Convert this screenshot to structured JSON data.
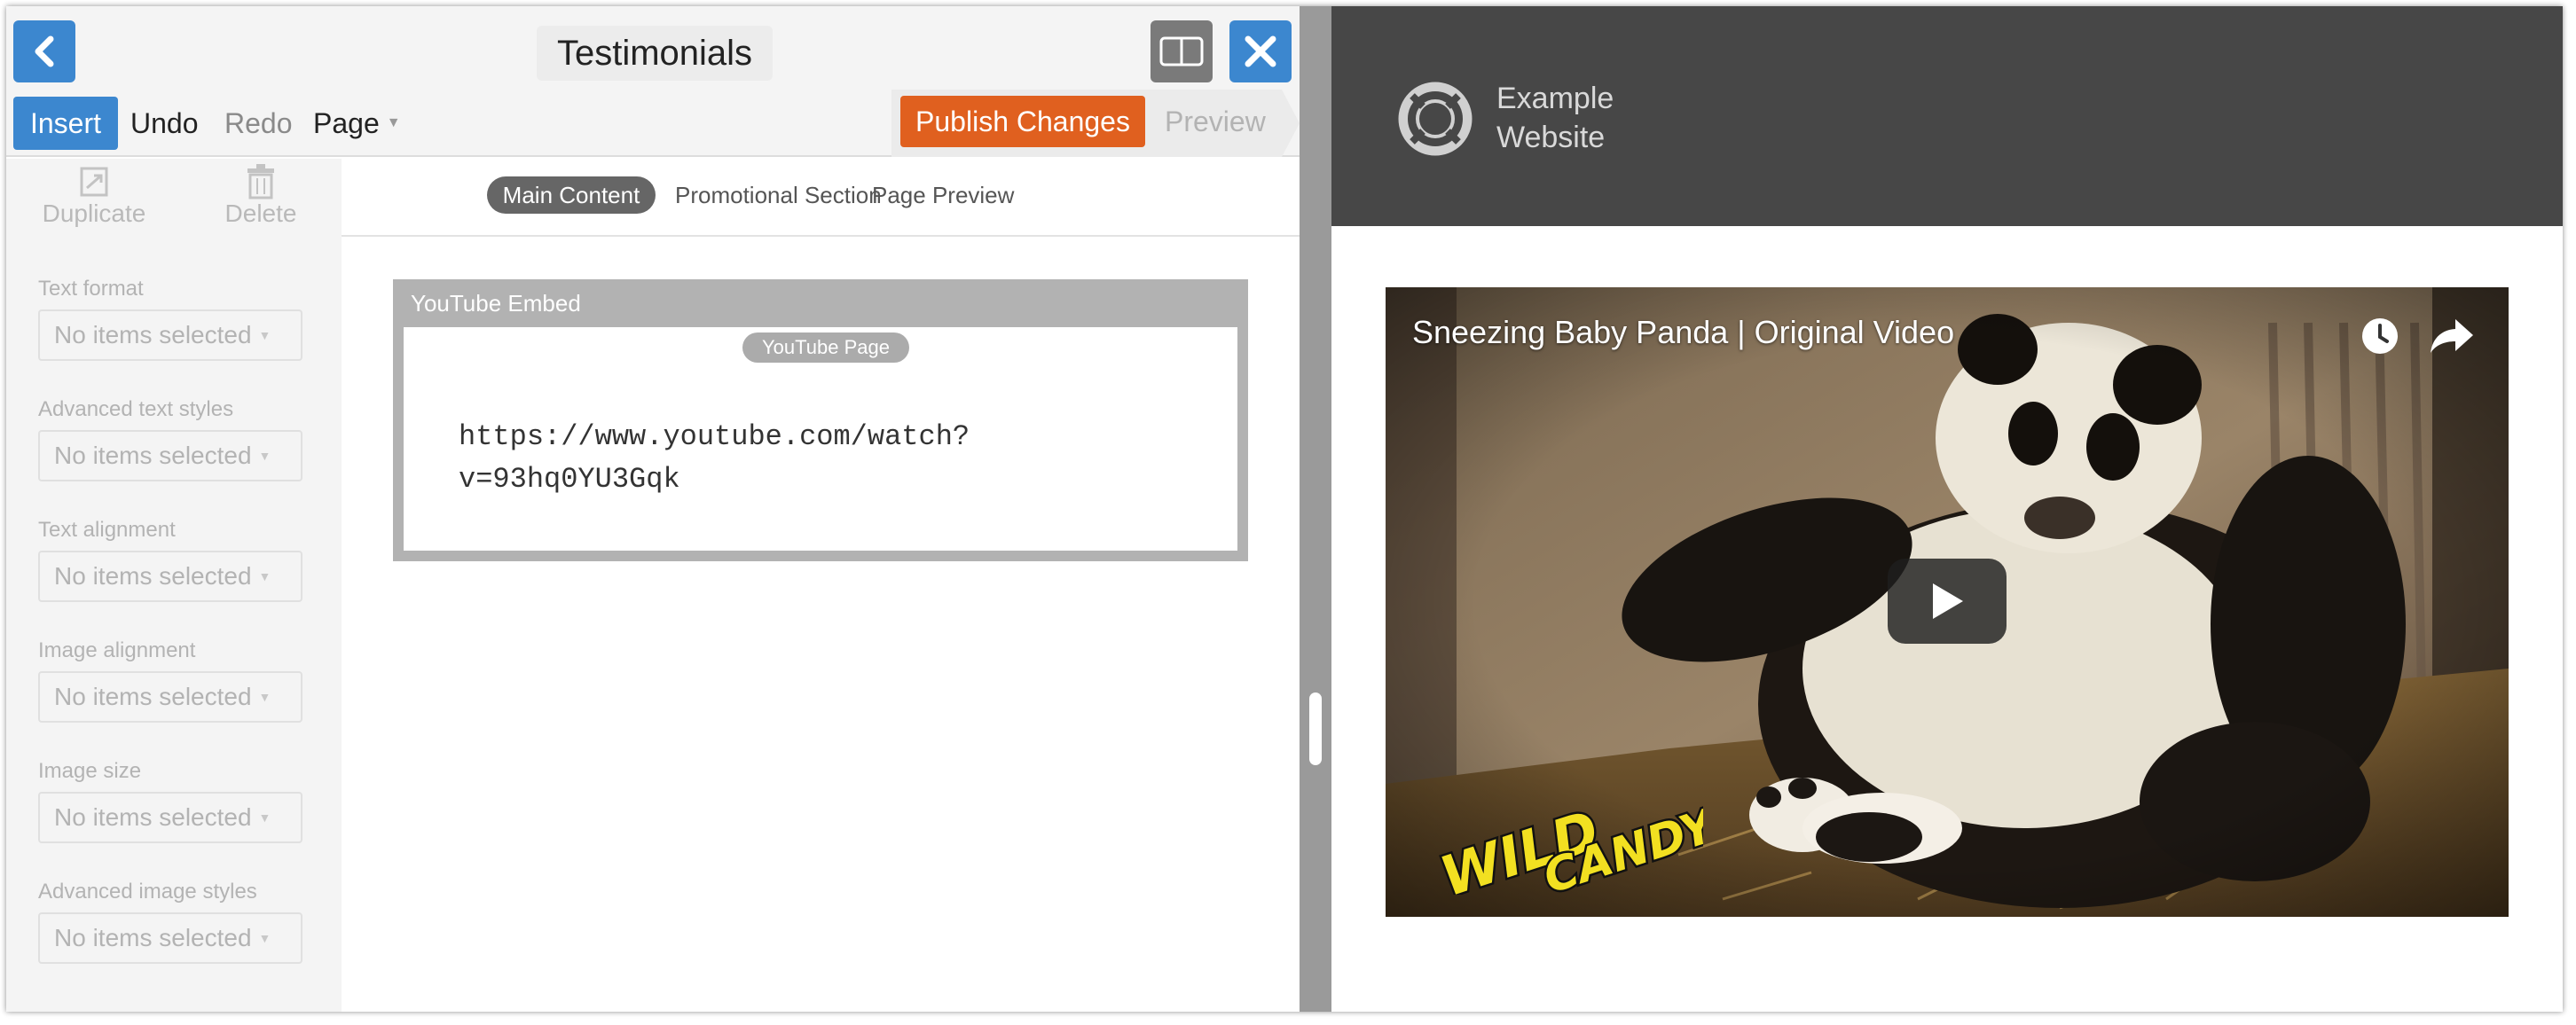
{
  "editor": {
    "title": "Testimonials",
    "toolbar": {
      "insert_label": "Insert",
      "undo_label": "Undo",
      "redo_label": "Redo",
      "page_label": "Page",
      "publish_label": "Publish Changes",
      "preview_label": "Preview"
    },
    "side": {
      "duplicate_label": "Duplicate",
      "delete_label": "Delete",
      "formats": [
        {
          "label": "Text format",
          "value": "No items selected"
        },
        {
          "label": "Advanced text styles",
          "value": "No items selected"
        },
        {
          "label": "Text alignment",
          "value": "No items selected"
        },
        {
          "label": "Image alignment",
          "value": "No items selected"
        },
        {
          "label": "Image size",
          "value": "No items selected"
        },
        {
          "label": "Advanced image styles",
          "value": "No items selected"
        }
      ]
    },
    "tabs": [
      "Main Content",
      "Promotional Section",
      "Page Preview"
    ],
    "active_tab": "Main Content",
    "embed": {
      "block_title": "YouTube Embed",
      "badge": "YouTube Page",
      "url_line1": "https://www.youtube.com/watch?",
      "url_line2": "v=93hq0YU3Gqk"
    }
  },
  "preview": {
    "site_name_line1": "Example",
    "site_name_line2": "Website",
    "video_title": "Sneezing Baby Panda | Original Video",
    "watermark": "WILD CANDY"
  },
  "colors": {
    "accent_blue": "#3c87cf",
    "publish_orange": "#e0601f",
    "site_header": "#474747"
  },
  "icons": [
    "back-arrow-icon",
    "split-view-icon",
    "close-icon",
    "duplicate-icon",
    "trash-icon",
    "lifebuoy-logo-icon",
    "clock-icon",
    "share-arrow-icon",
    "play-icon"
  ]
}
